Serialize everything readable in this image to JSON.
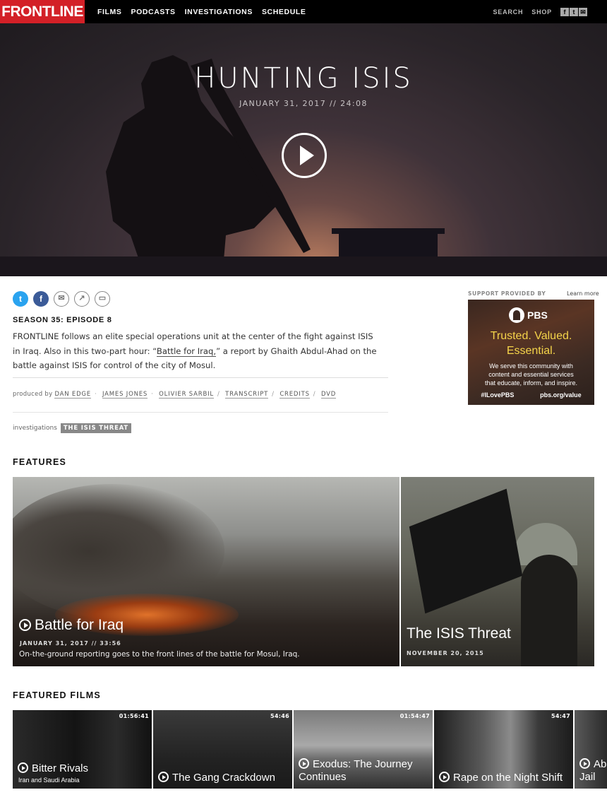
{
  "nav": {
    "logo": "FRONTLINE",
    "links": [
      "FILMS",
      "PODCASTS",
      "INVESTIGATIONS",
      "SCHEDULE"
    ],
    "search": "SEARCH",
    "shop": "SHOP",
    "social_icons": [
      "facebook-icon",
      "twitter-icon",
      "email-icon"
    ]
  },
  "hero": {
    "title": "HUNTING ISIS",
    "meta": "JANUARY 31, 2017  //  24:08"
  },
  "share_icons": [
    "twitter-icon",
    "facebook-icon",
    "email-icon",
    "share-icon",
    "comment-icon"
  ],
  "episode": {
    "season": "SEASON 35: EPISODE 8",
    "desc_1": "FRONTLINE follows an elite special operations unit at the center of the fight against ISIS in Iraq. Also in this two-part hour: “",
    "desc_link": "Battle for Iraq,",
    "desc_2": "” a report by Ghaith Abdul-Ahad on the battle against ISIS for control of the city of Mosul.",
    "produced_by": "produced by",
    "credits": [
      "DAN EDGE",
      "JAMES JONES",
      "OLIVIER SARBIL",
      "TRANSCRIPT",
      "CREDITS",
      "DVD"
    ],
    "investigations_label": "investigations",
    "investigation_tag": "THE ISIS THREAT"
  },
  "ad": {
    "label": "SUPPORT PROVIDED BY",
    "learn_more": "Learn more",
    "brand": "PBS",
    "headline_1": "Trusted. Valued.",
    "headline_2": "Essential.",
    "body_1": "We serve this community with",
    "body_2": "content and essential services",
    "body_3": "that educate, inform, and inspire.",
    "hashtag": "#ILovePBS",
    "url": "pbs.org/value"
  },
  "features": {
    "title": "FEATURES",
    "main": {
      "title": "Battle for Iraq",
      "meta": "JANUARY 31, 2017  //  33:56",
      "desc": "On-the-ground reporting goes to the front lines of the battle for Mosul, Iraq."
    },
    "side": {
      "title": "The ISIS Threat",
      "meta": "NOVEMBER 20, 2015"
    }
  },
  "films": {
    "title": "FEATURED FILMS",
    "items": [
      {
        "title": "Bitter Rivals",
        "subtitle": "Iran and Saudi Arabia",
        "duration": "01:56:41"
      },
      {
        "title": "The Gang Crackdown",
        "duration": "54:46"
      },
      {
        "title_1": "Exodus: The Journey",
        "title_2": "Continues",
        "duration": "01:54:47"
      },
      {
        "title": "Rape on the Night Shift",
        "duration": "54:47"
      },
      {
        "title_1": "Aba",
        "title_2": "Jail"
      }
    ]
  }
}
